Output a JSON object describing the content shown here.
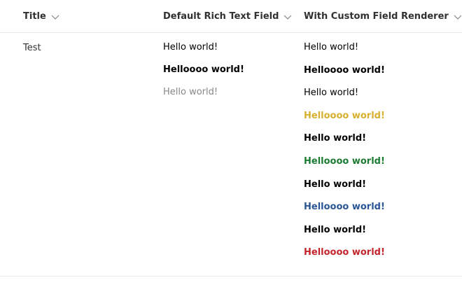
{
  "columns": {
    "title": "Title",
    "default": "Default Rich Text Field",
    "custom": "With Custom Field Renderer"
  },
  "row": {
    "title": "Test",
    "default_lines": [
      {
        "text": "Hello world!",
        "bold": false,
        "color": "#000000"
      },
      {
        "text": "Helloooo world!",
        "bold": true,
        "color": "#000000"
      },
      {
        "text": "Hello world!",
        "bold": false,
        "color": "#8a8886"
      }
    ],
    "custom_lines": [
      {
        "text": "Hello world!",
        "bold": false,
        "color": "#000000"
      },
      {
        "text": "Helloooo world!",
        "bold": true,
        "color": "#000000"
      },
      {
        "text": "Hello world!",
        "bold": false,
        "color": "#000000"
      },
      {
        "text": "Helloooo world!",
        "bold": true,
        "color": "#d6b02e"
      },
      {
        "text": "Hello world!",
        "bold": true,
        "color": "#000000"
      },
      {
        "text": "Helloooo world!",
        "bold": true,
        "color": "#1e7b34"
      },
      {
        "text": "Hello world!",
        "bold": true,
        "color": "#000000"
      },
      {
        "text": "Helloooo world!",
        "bold": true,
        "color": "#2b5797"
      },
      {
        "text": "Hello world!",
        "bold": true,
        "color": "#000000"
      },
      {
        "text": "Helloooo world!",
        "bold": true,
        "color": "#c4262e"
      }
    ]
  },
  "icons": {
    "sort": "chevron-down-icon"
  }
}
